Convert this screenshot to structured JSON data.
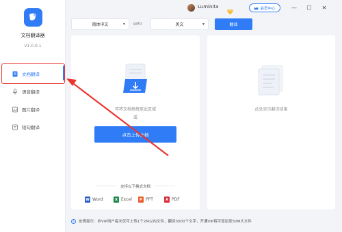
{
  "app": {
    "name": "文档翻译器",
    "version": "V1.0.0.1"
  },
  "titlebar": {
    "username": "Luminita",
    "member_center": "会员中心",
    "minimize": "—",
    "maximize": "☐",
    "close": "✕"
  },
  "sidebar": {
    "items": [
      {
        "label": "文档翻译",
        "icon": "document-icon",
        "active": true
      },
      {
        "label": "语音翻译",
        "icon": "microphone-icon",
        "active": false
      },
      {
        "label": "图片翻译",
        "icon": "image-icon",
        "active": false
      },
      {
        "label": "短句翻译",
        "icon": "text-icon",
        "active": false
      }
    ]
  },
  "toolbar": {
    "source_lang": "简体中文",
    "goto_label": "goto",
    "target_lang": "英文",
    "translate_label": "翻译"
  },
  "left_panel": {
    "drop_hint": "可将文档拖拽至此区域",
    "or_text": "或",
    "upload_label": "点击上传文档",
    "formats_title": "支持以下格式文档",
    "formats": [
      {
        "label": "Word",
        "color": "#2b5fc4",
        "letter": "W"
      },
      {
        "label": "Excel",
        "color": "#1f8a4c",
        "letter": "X"
      },
      {
        "label": "PPT",
        "color": "#e8612c",
        "letter": "P"
      },
      {
        "label": "PDF",
        "color": "#d6303c",
        "letter": "A"
      }
    ]
  },
  "right_panel": {
    "result_hint": "此处显示翻译结果"
  },
  "footer": {
    "text": "友情提示：非VIP用户每次仅可上传1个2M以内文件，翻译3000个文字，开通VIP将可增加至50M大文件"
  },
  "colors": {
    "accent": "#2f7cf6",
    "annotation": "#e8362f"
  }
}
